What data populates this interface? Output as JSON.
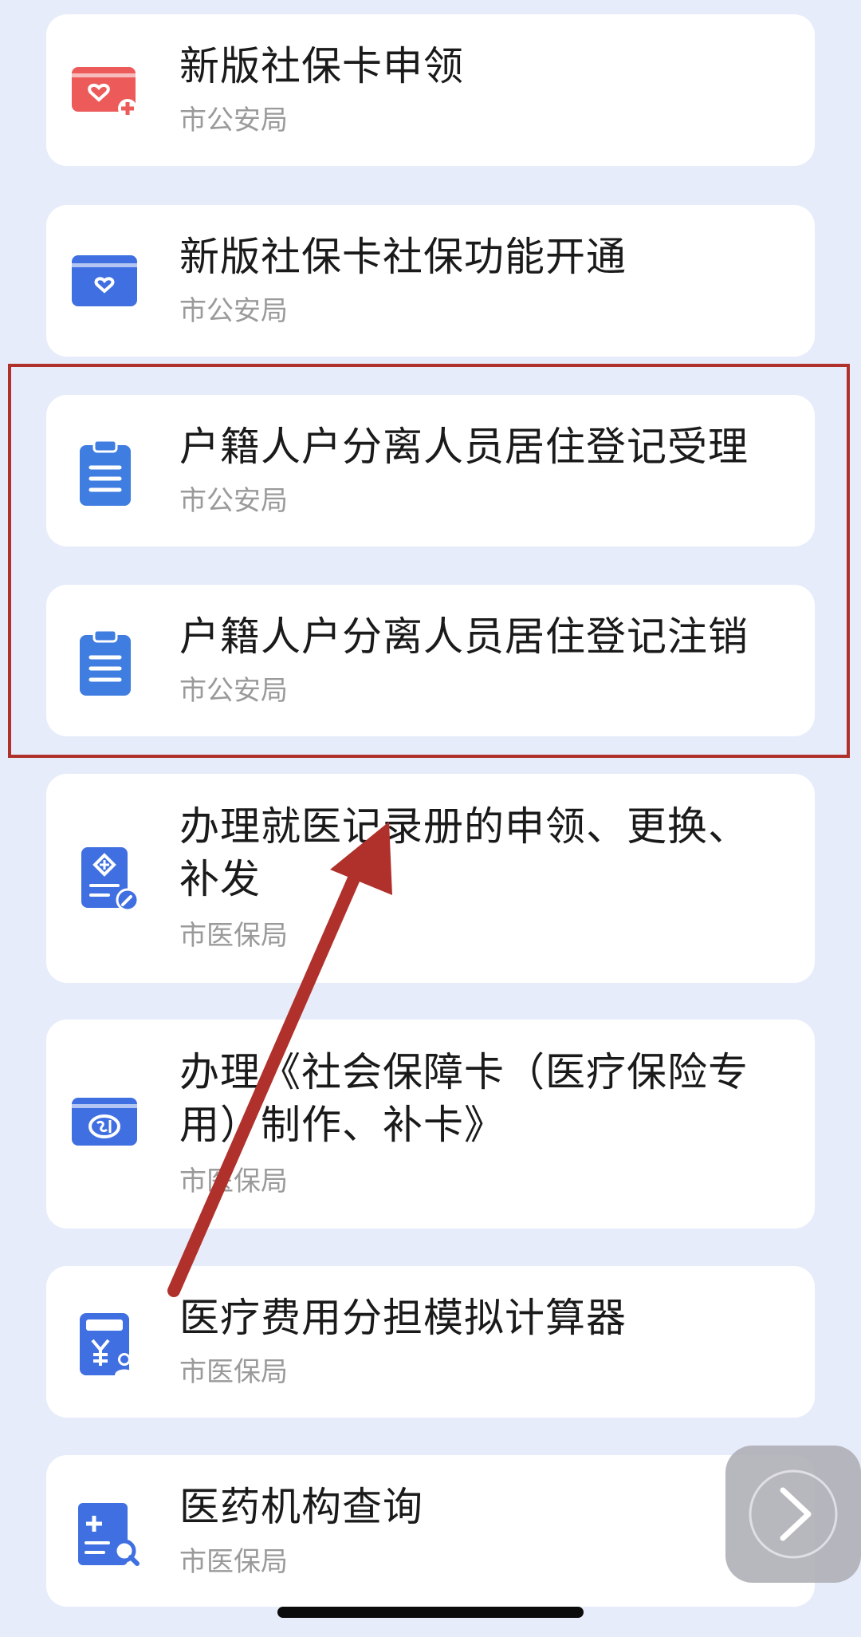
{
  "services": [
    {
      "title": "新版社保卡申领",
      "dept": "市公安局",
      "icon": "red-social-card-add-icon"
    },
    {
      "title": "新版社保卡社保功能开通",
      "dept": "市公安局",
      "icon": "blue-social-card-icon"
    },
    {
      "title": "户籍人户分离人员居住登记受理",
      "dept": "市公安局",
      "icon": "clipboard-icon"
    },
    {
      "title": "户籍人户分离人员居住登记注销",
      "dept": "市公安局",
      "icon": "clipboard-icon"
    },
    {
      "title": "办理就医记录册的申领、更换、补发",
      "dept": "市医保局",
      "icon": "medical-record-edit-icon"
    },
    {
      "title": "办理《社会保障卡（医疗保险专用）制作、补卡》",
      "dept": "市医保局",
      "icon": "si-card-icon"
    },
    {
      "title": "医疗费用分担模拟计算器",
      "dept": "市医保局",
      "icon": "yuan-calculator-icon"
    },
    {
      "title": "医药机构查询",
      "dept": "市医保局",
      "icon": "medical-institution-search-icon"
    }
  ],
  "colors": {
    "background": "#e6ecfa",
    "card": "#ffffff",
    "icon_blue": "#3f6fe0",
    "icon_red": "#ec5a5a",
    "annotation_red": "#b0312b"
  }
}
